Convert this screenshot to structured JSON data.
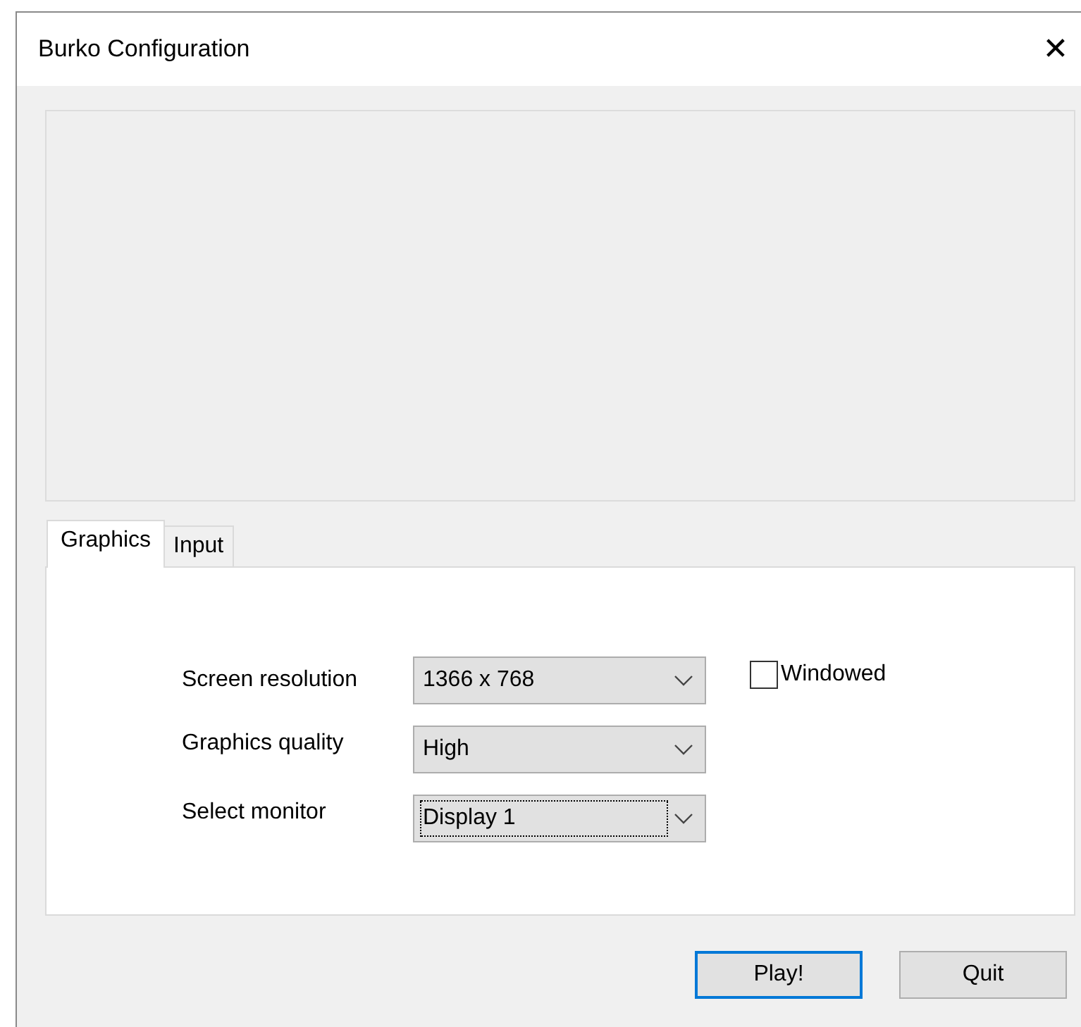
{
  "window": {
    "title": "Burko Configuration",
    "close": "✕"
  },
  "tabs": [
    {
      "label": "Graphics",
      "selected": true
    },
    {
      "label": "Input",
      "selected": false
    }
  ],
  "settings": [
    {
      "label": "Screen resolution",
      "value": "1366 x 768",
      "focused": false
    },
    {
      "label": "Graphics quality",
      "value": "High",
      "focused": false
    },
    {
      "label": "Select monitor",
      "value": "Display 1",
      "focused": true
    }
  ],
  "windowed": {
    "label": "Windowed",
    "checked": false
  },
  "buttons": [
    {
      "label": "Play!",
      "default": true
    },
    {
      "label": "Quit",
      "default": false
    }
  ]
}
